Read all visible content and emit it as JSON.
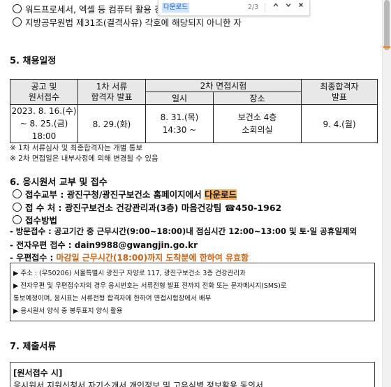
{
  "find_bar": {
    "query": "다운로드",
    "count": "2/3",
    "prev_icon": "chevron-up",
    "next_icon": "chevron-down",
    "close_icon": "close"
  },
  "qualifications": {
    "item1": "워드프로세서, 엑셀 등 컴퓨터 활용 경험자",
    "item2": "지방공무원법 제31조(결격사유) 각호에 해당되지 아니한 자"
  },
  "section5": {
    "title": "5. 채용일정",
    "headers": {
      "col1": "공고 및\n원서접수",
      "col1_line1": "공고 및",
      "col1_line2": "원서접수",
      "col2_line1": "1차 서류",
      "col2_line2": "합격자 발표",
      "col3": "2차 면접시험",
      "col3_sub1": "일시",
      "col3_sub2": "장소",
      "col4_line1": "최종합격자",
      "col4_line2": "발표"
    },
    "row": {
      "period_line1": "2023. 8. 16.(수)",
      "period_line2": "~ 8. 25.(금) 18:00",
      "first_result": "8. 29.(화)",
      "interview_date_line1": "8. 31.(목)",
      "interview_date_line2": "14:30 ~",
      "interview_place_line1": "보건소 4층",
      "interview_place_line2": "소회의실",
      "final_result": "9. 4.(월)"
    },
    "note1": "※ 1차 서류심사 및 최종합격자는 개별 통보",
    "note2": "※ 2차 면접일은 내부사정에 의해 변경될 수 있음"
  },
  "section6": {
    "title": "6. 응시원서 교부 및 접수",
    "issue_label": "접수교부 : 광진구청/광진구보건소 홈페이지에서 ",
    "issue_highlight": "다운로드",
    "place": "접 수 처 : 광진구보건소 건강관리과(3층) 마음건강팀 ☎450-1962",
    "method": "접수방법",
    "visit": "- 방문접수 : 공고기간 중 근무시간(9:00~18:00)내 점심시간 12:00~13:00 및 토·일 공휴일제외",
    "email": "- 전자우편 접수 : dain9988@gwangjin.go.kr",
    "post_prefix": "- 우편접수 : ",
    "post_emph": "마감일 근무시간(18:00)까지 도착분에 한하여 유효함",
    "box": {
      "line1": "▶ 주소 : (우50206) 서울특별시 광진구 자양로 117, 광진구보건소 3층 건강관리과",
      "line2": "▶ 전자우편 및 우편접수자의 경우 응시번호는 서류전형 발표 전까지 전화 또는 문자메시지(SMS)로",
      "line3": "통보예정이며, 응시표는 서류전형 합격자에 한하여 면접시험장에서 배부",
      "line4": "▶ 응시원서 양식 중 봉투표지 양식 활용"
    }
  },
  "section7": {
    "title": "7. 제출서류",
    "box_title": "[원서접수 시]",
    "box_line1": "응시원서 지원신청서 자기소개서 개인정보 및 고유식별 정보활용 동의서"
  },
  "colors": {
    "highlight": "#f7b45f",
    "emphasis": "#d4620f",
    "table_header": "#e8e8e8",
    "scroll_accent": "#f28c28"
  }
}
